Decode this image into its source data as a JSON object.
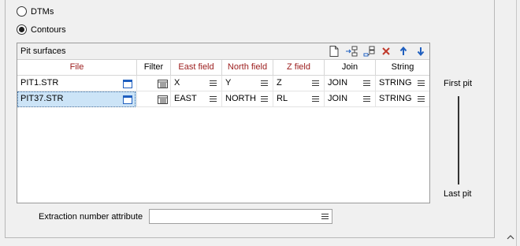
{
  "options": {
    "dtms": {
      "label": "DTMs",
      "checked": false
    },
    "contours": {
      "label": "Contours",
      "checked": true
    }
  },
  "grid": {
    "title": "Pit surfaces",
    "toolbar": [
      "new-file-icon",
      "insert-row-icon",
      "append-row-icon",
      "delete-icon",
      "move-up-icon",
      "move-down-icon"
    ],
    "columns": [
      "File",
      "Filter",
      "East field",
      "North field",
      "Z field",
      "Join",
      "String"
    ],
    "rows": [
      {
        "file": "PIT1.STR",
        "east": "X",
        "north": "Y",
        "z": "Z",
        "join": "JOIN",
        "string": "STRING",
        "selected": false
      },
      {
        "file": "PIT37.STR",
        "east": "EAST",
        "north": "NORTH",
        "z": "RL",
        "join": "JOIN",
        "string": "STRING",
        "selected": true
      }
    ]
  },
  "order": {
    "first": "First pit",
    "last": "Last pit"
  },
  "extraction": {
    "label": "Extraction number attribute",
    "value": ""
  },
  "colors": {
    "required_header": "#9b1b1b",
    "selection": "#cce4f7",
    "delete": "#c0392b",
    "arrows": "#1f5fbf"
  }
}
